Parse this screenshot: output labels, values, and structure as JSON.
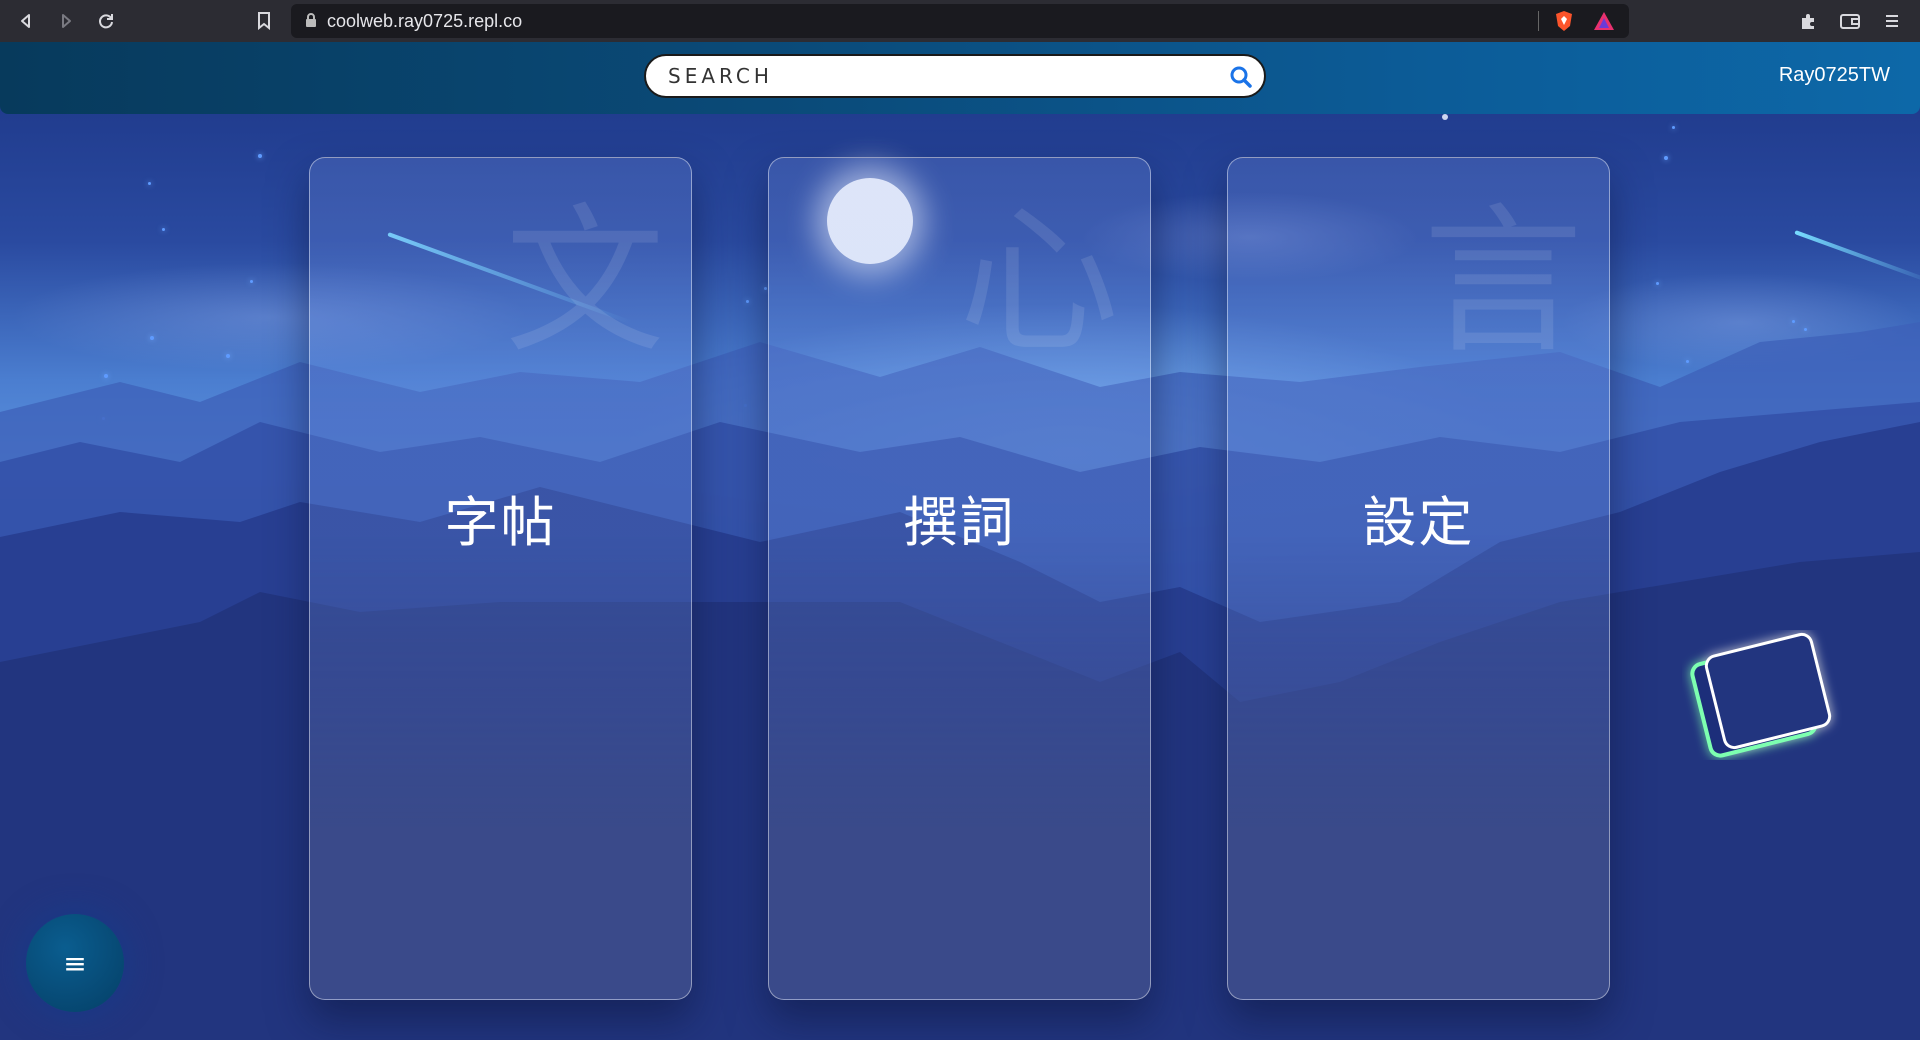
{
  "browser": {
    "url": "coolweb.ray0725.repl.co"
  },
  "header": {
    "search_placeholder": "SEARCH",
    "username": "Ray0725TW"
  },
  "cards": [
    {
      "label": "字帖",
      "bg_char": "文"
    },
    {
      "label": "撰詞",
      "bg_char": "心"
    },
    {
      "label": "設定",
      "bg_char": "言"
    }
  ],
  "menu_button": {
    "icon": "≡"
  },
  "colors": {
    "topbar_start": "#073a5c",
    "topbar_end": "#0d68a8",
    "search_icon": "#1a73e8",
    "cube_glow": "#7dffb0"
  }
}
